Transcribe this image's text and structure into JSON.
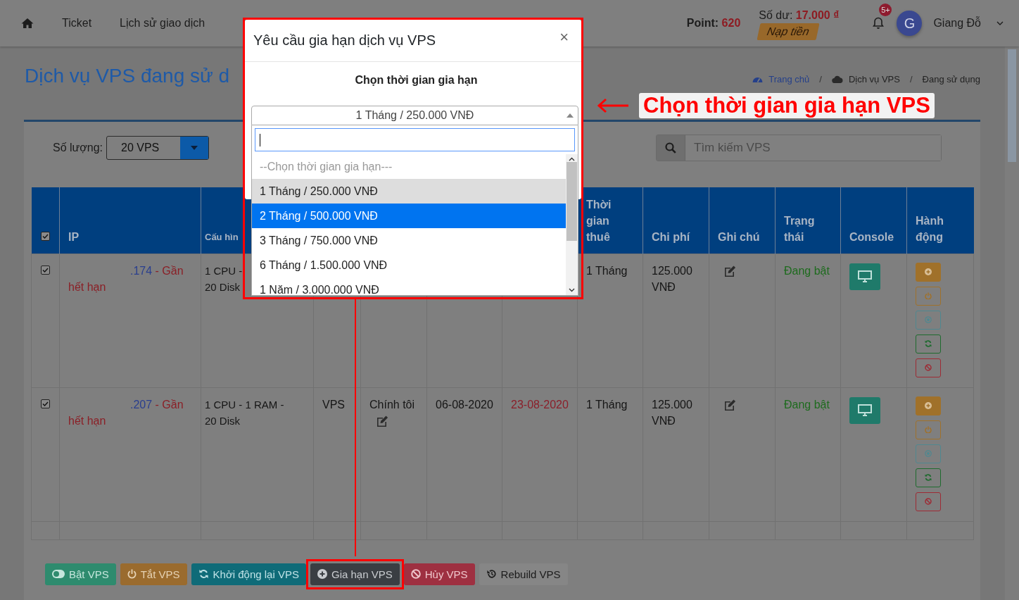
{
  "navbar": {
    "links": [
      {
        "label": "Ticket"
      },
      {
        "label": "Lịch sử giao dịch"
      }
    ],
    "point_label": "Point:",
    "point_value": "620",
    "balance_label": "Số dư:",
    "balance_value": "17.000 ₫",
    "topup_button": "Nạp tiền",
    "notification_badge": "5+",
    "avatar_initial": "G",
    "user_name": "Giang Đỗ"
  },
  "page_title": "Dịch vụ VPS đang sử d",
  "breadcrumb": [
    {
      "label": "Trang chủ",
      "kind": "home"
    },
    {
      "label": "/",
      "kind": "separator"
    },
    {
      "label": "Dịch vụ VPS",
      "kind": "cloud"
    },
    {
      "label": "/",
      "kind": "separator"
    },
    {
      "label": "Đang sử dụng",
      "kind": "current"
    }
  ],
  "quantity": {
    "label": "Số lượng:",
    "value": "20 VPS"
  },
  "search": {
    "placeholder": "Tìm kiếm VPS"
  },
  "table": {
    "header_checked": true,
    "columns": [
      {
        "label": "IP"
      },
      {
        "label": "Cấu hìn"
      },
      {
        "label": "Thời gian thuê"
      },
      {
        "label": "Chi phí"
      },
      {
        "label": "Ghi chú"
      },
      {
        "label": "Trạng thái"
      },
      {
        "label": "Console"
      },
      {
        "label": "Hành động"
      }
    ],
    "rows": [
      {
        "checked": true,
        "ip": ".174",
        "ip_note": "- Gần hết hạn",
        "config": "1 CPU -\n20 Disk",
        "rental": "1 Tháng",
        "cost": "125.000 VNĐ",
        "status": "Đang bật"
      },
      {
        "checked": true,
        "ip": ".207",
        "ip_note": "- Gần hết hạn",
        "config": "1 CPU - 1 RAM -\n20 Disk",
        "type": "VPS",
        "owner": "Chính tôi",
        "created": "06-08-2020",
        "expires": "23-08-2020",
        "rental": "1 Tháng",
        "cost": "125.000 VNĐ",
        "status": "Đang bật"
      }
    ]
  },
  "bulk_actions": [
    {
      "label": "Bật VPS",
      "kind": "on",
      "highlighted": false
    },
    {
      "label": "Tắt VPS",
      "kind": "off",
      "highlighted": false
    },
    {
      "label": "Khởi động lại VPS",
      "kind": "restart",
      "highlighted": false
    },
    {
      "label": "Gia hạn VPS",
      "kind": "renew",
      "highlighted": true
    },
    {
      "label": "Hủy VPS",
      "kind": "cancel",
      "highlighted": false
    },
    {
      "label": "Rebuild VPS",
      "kind": "rebuild",
      "highlighted": false
    }
  ],
  "modal": {
    "title": "Yêu cầu gia hạn dịch vụ VPS",
    "close": "×",
    "subtitle": "Chọn thời gian gia hạn",
    "select": {
      "value": "1 Tháng / 250.000 VNĐ",
      "expanded": true,
      "options": [
        {
          "label": "--Chọn thời gian gia hạn---",
          "kind": "placeholder",
          "selected": false,
          "highlighted": false
        },
        {
          "label": "1 Tháng / 250.000 VNĐ",
          "kind": "option",
          "selected": true,
          "highlighted": false
        },
        {
          "label": "2 Tháng / 500.000 VNĐ",
          "kind": "option",
          "selected": false,
          "highlighted": true
        },
        {
          "label": "3 Tháng / 750.000 VNĐ",
          "kind": "option",
          "selected": false,
          "highlighted": false
        },
        {
          "label": "6 Tháng / 1.500.000 VNĐ",
          "kind": "option",
          "selected": false,
          "highlighted": false
        },
        {
          "label": "1 Năm / 3.000.000 VNĐ",
          "kind": "option",
          "selected": false,
          "highlighted": false
        }
      ]
    }
  },
  "annotation": {
    "text": "Chọn thời gian gia hạn VPS"
  }
}
